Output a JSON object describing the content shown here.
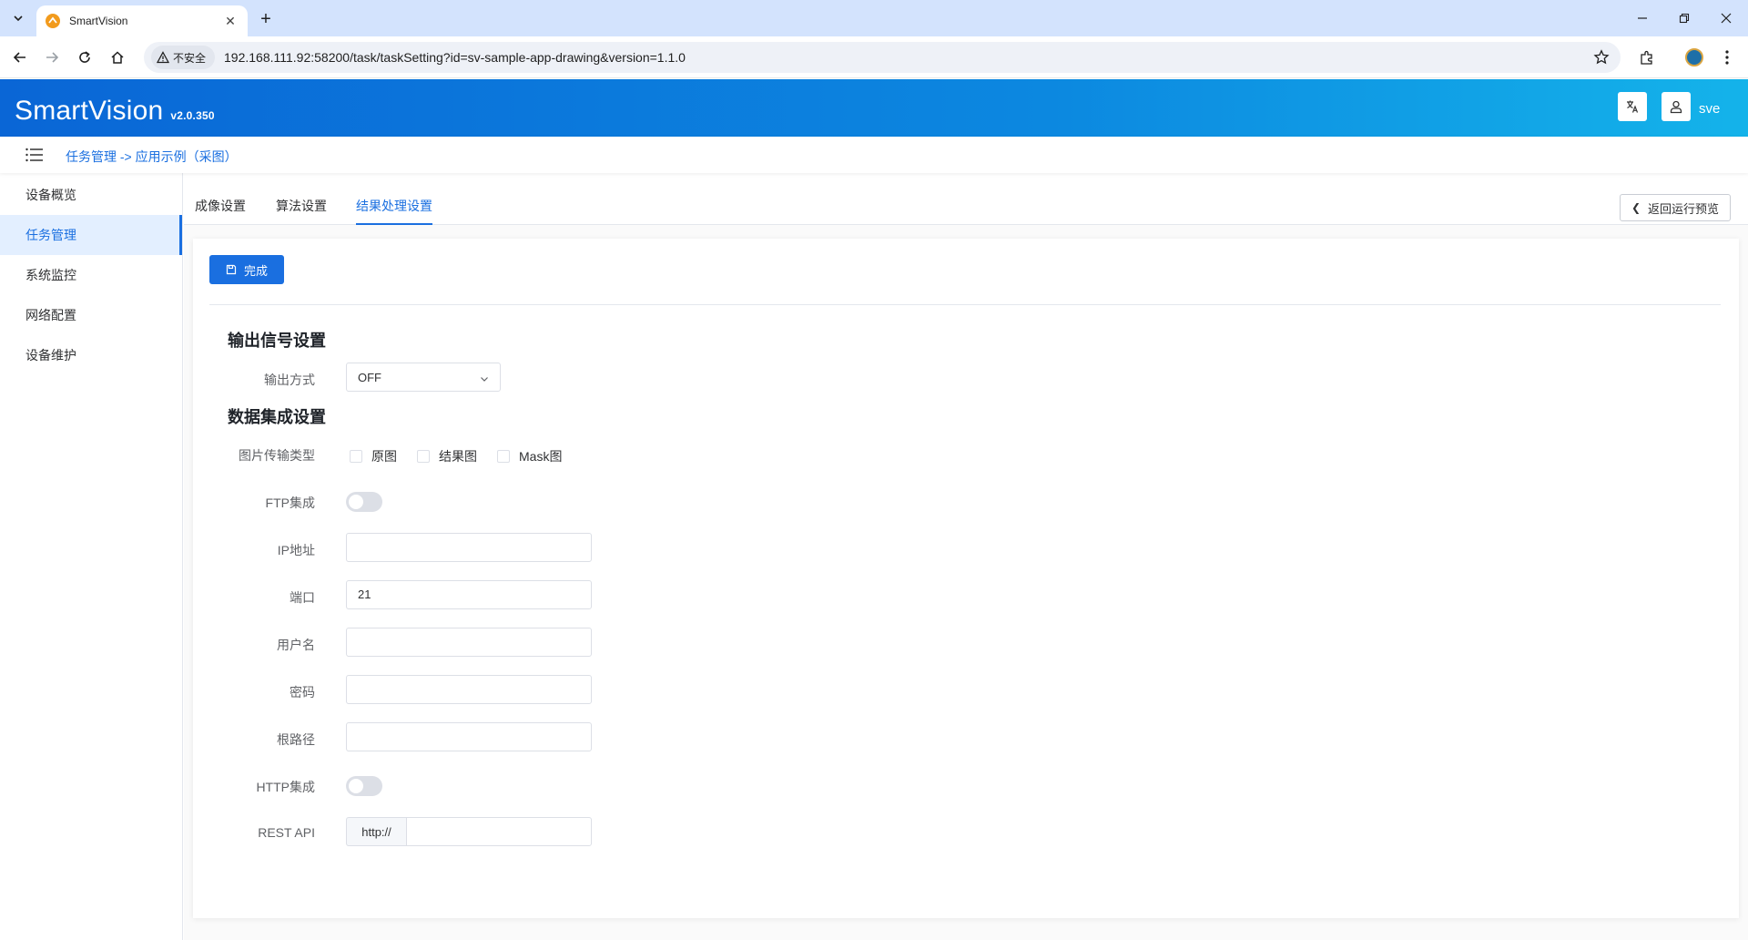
{
  "browser": {
    "tab_title": "SmartVision",
    "new_tab_symbol": "+",
    "insecure_label": "不安全",
    "url": "192.168.111.92:58200/task/taskSetting?id=sv-sample-app-drawing&version=1.1.0"
  },
  "header": {
    "brand": "SmartVision",
    "version": "v2.0.350",
    "user": "sve"
  },
  "breadcrumb": "任务管理 -> 应用示例（采图）",
  "sidebar": {
    "items": [
      {
        "label": "设备概览"
      },
      {
        "label": "任务管理"
      },
      {
        "label": "系统监控"
      },
      {
        "label": "网络配置"
      },
      {
        "label": "设备维护"
      }
    ],
    "active_index": 1
  },
  "page_tabs": {
    "items": [
      {
        "label": "成像设置"
      },
      {
        "label": "算法设置"
      },
      {
        "label": "结果处理设置"
      }
    ],
    "active_index": 2,
    "back_button": "返回运行预览"
  },
  "form": {
    "done_button": "完成",
    "output_section": {
      "title": "输出信号设置",
      "output_mode_label": "输出方式",
      "output_mode_value": "OFF"
    },
    "data_section": {
      "title": "数据集成设置",
      "image_type_label": "图片传输类型",
      "image_types": [
        {
          "label": "原图",
          "checked": false
        },
        {
          "label": "结果图",
          "checked": false
        },
        {
          "label": "Mask图",
          "checked": false
        }
      ],
      "ftp_label": "FTP集成",
      "ftp_enabled": false,
      "ip_label": "IP地址",
      "ip_value": "",
      "port_label": "端口",
      "port_value": "21",
      "username_label": "用户名",
      "username_value": "",
      "password_label": "密码",
      "password_value": "",
      "root_path_label": "根路径",
      "root_path_value": "",
      "http_label": "HTTP集成",
      "http_enabled": false,
      "rest_api_label": "REST API",
      "rest_api_prefix": "http://",
      "rest_api_value": ""
    }
  },
  "colors": {
    "primary": "#1a6fe0",
    "header_gradient_start": "#0a66d6",
    "header_gradient_end": "#14b3ea",
    "browser_tabbar": "#d3e3fd"
  }
}
